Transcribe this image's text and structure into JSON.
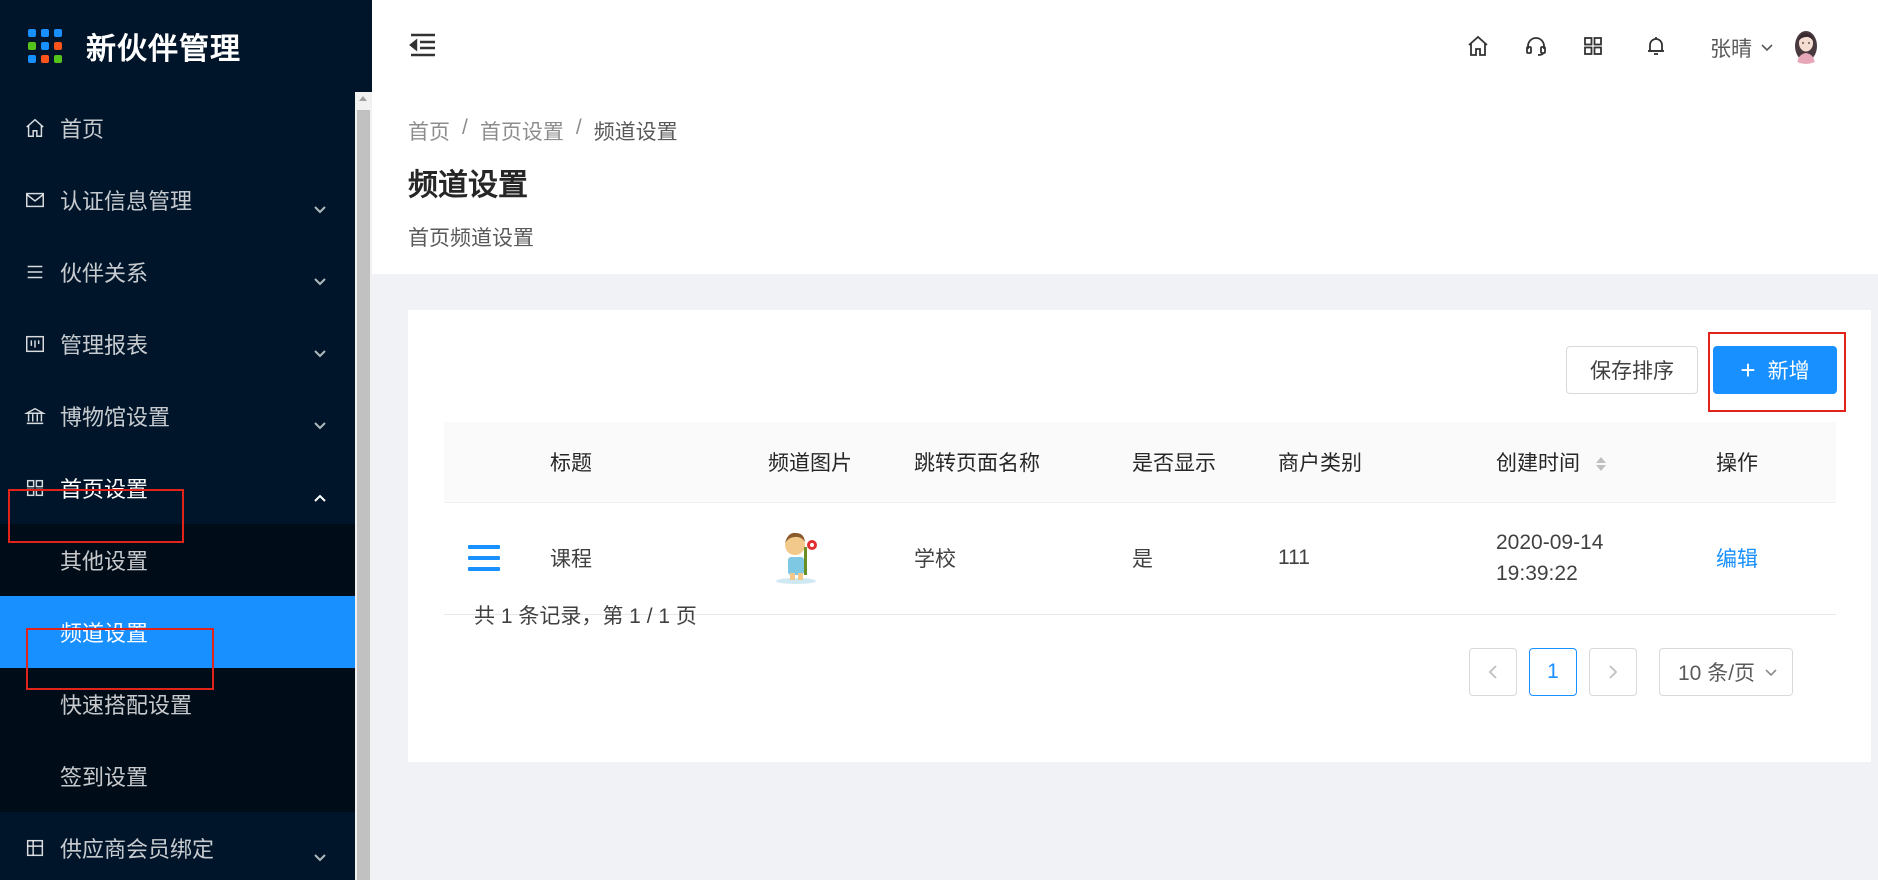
{
  "app": {
    "title": "新伙伴管理",
    "logo_dot_colors": [
      "#1890ff",
      "#1890ff",
      "#1890ff",
      "#52c41a",
      "#1890ff",
      "#fa541c",
      "#1890ff",
      "#fa541c",
      "#52c41a"
    ]
  },
  "sidebar": {
    "items": [
      {
        "label": "首页",
        "icon": "home-icon"
      },
      {
        "label": "认证信息管理",
        "icon": "mail-icon"
      },
      {
        "label": "伙伴关系",
        "icon": "list-icon"
      },
      {
        "label": "管理报表",
        "icon": "report-icon"
      },
      {
        "label": "博物馆设置",
        "icon": "bank-icon"
      },
      {
        "label": "首页设置",
        "icon": "appstore-icon"
      }
    ],
    "submenu": [
      {
        "label": "其他设置"
      },
      {
        "label": "频道设置"
      },
      {
        "label": "快速搭配设置"
      },
      {
        "label": "签到设置"
      }
    ],
    "after_item": {
      "label": "供应商会员绑定",
      "icon": "table-icon"
    },
    "active_color": "#1890ff"
  },
  "header": {
    "icons": [
      "home-icon",
      "headset-icon",
      "appstore-icon",
      "bell-icon"
    ],
    "user_name": "张晴"
  },
  "page": {
    "breadcrumb": [
      "首页",
      "首页设置",
      "频道设置"
    ],
    "breadcrumb_separator": "/",
    "title": "频道设置",
    "description": "首页频道设置"
  },
  "toolbar": {
    "save_order_label": "保存排序",
    "add_plus": "+",
    "add_label": "新增"
  },
  "table": {
    "columns": [
      "",
      "标题",
      "频道图片",
      "跳转页面名称",
      "是否显示",
      "商户类别",
      "创建时间",
      "操作"
    ],
    "rows": [
      {
        "title": "课程",
        "page_name": "学校",
        "visible": "是",
        "category": "111",
        "created_date": "2020-09-14",
        "created_time": "19:39:22",
        "action": "编辑"
      }
    ]
  },
  "pagination": {
    "summary": "共 1 条记录，第 1 / 1 页",
    "current": "1",
    "page_size": "10 条/页"
  }
}
